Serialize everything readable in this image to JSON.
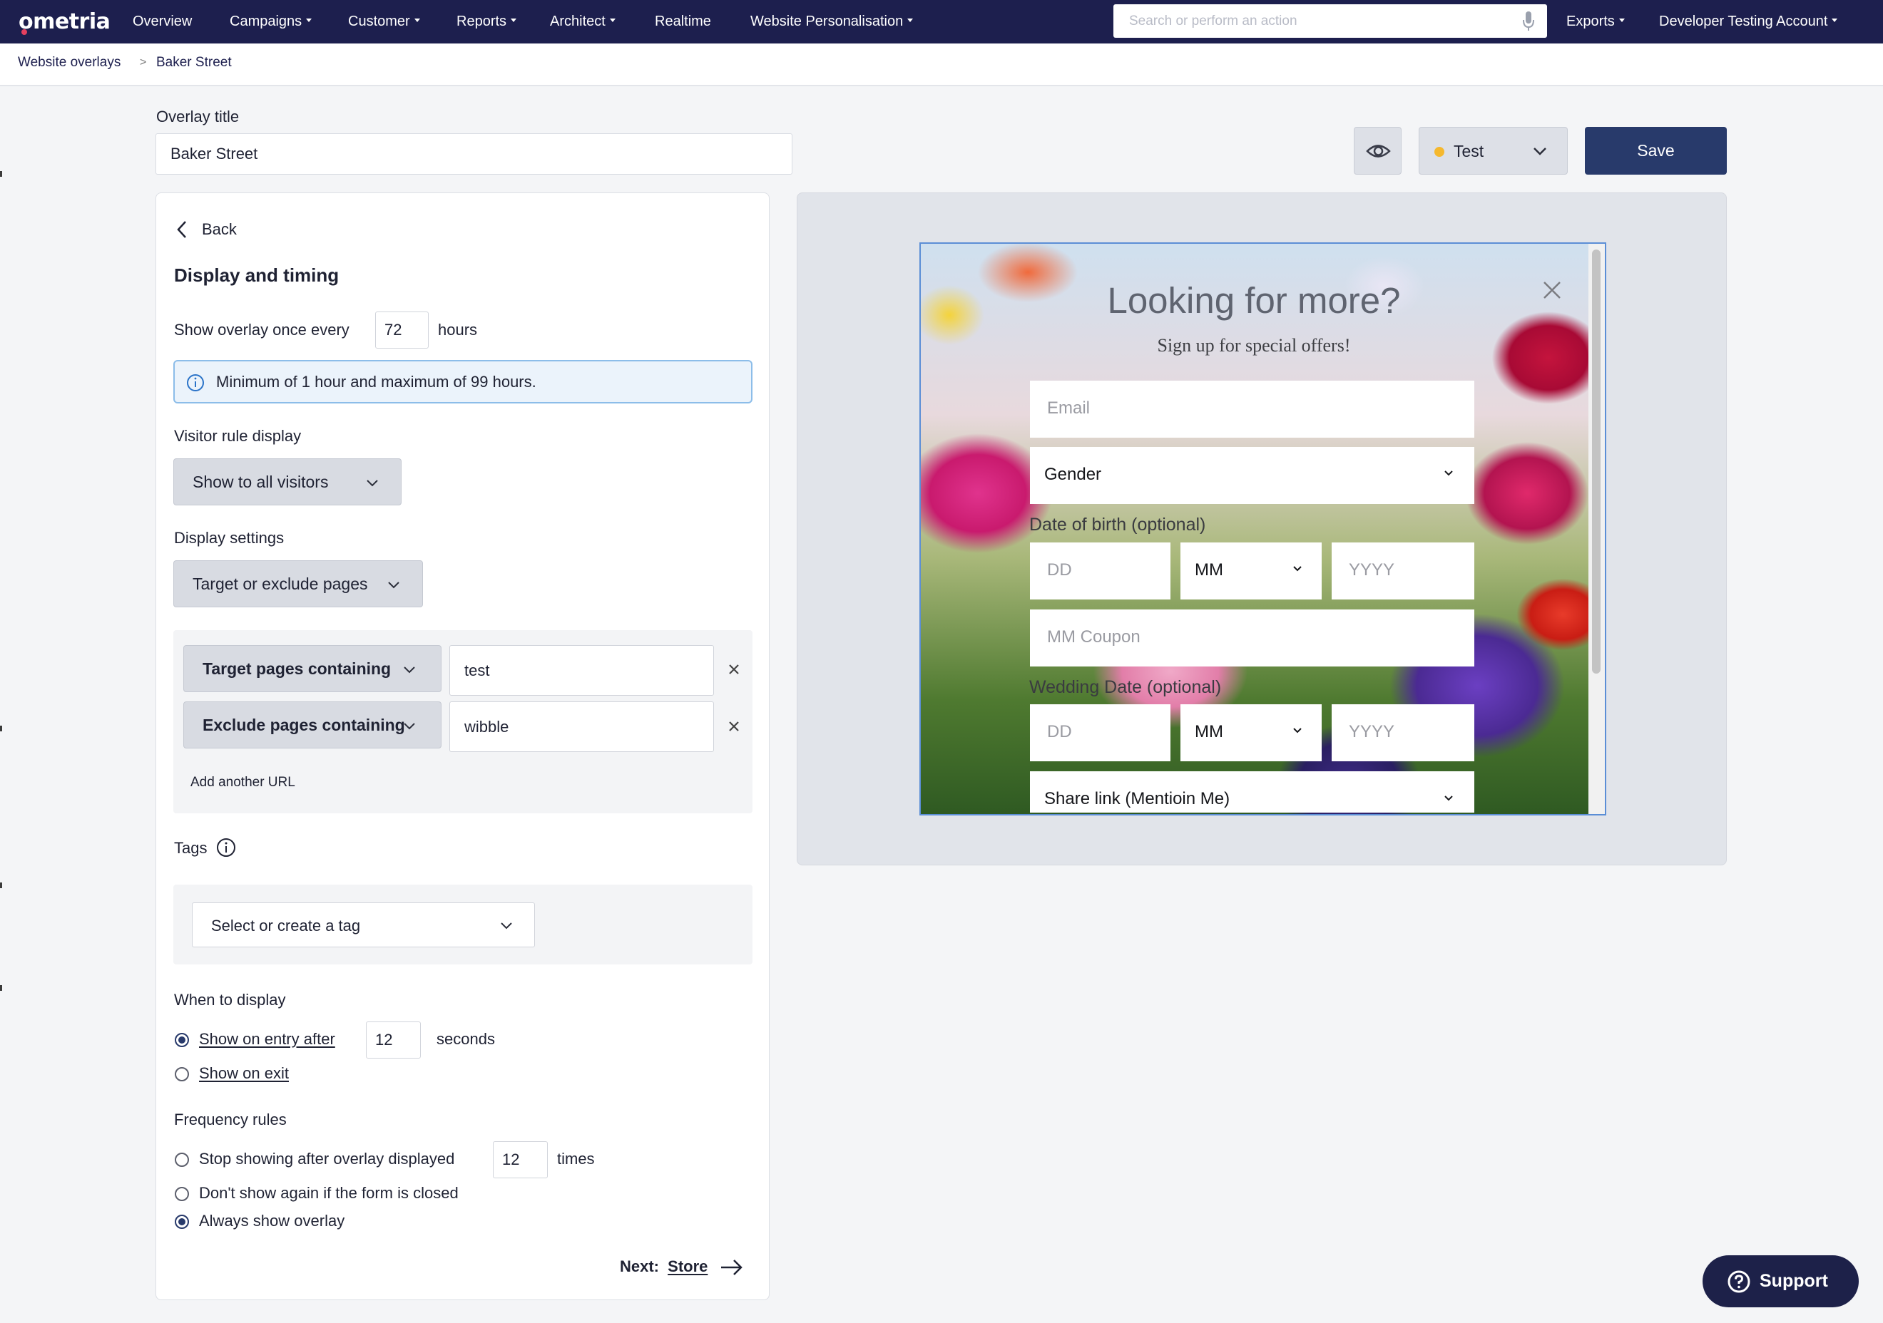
{
  "nav": {
    "logo": "ometria",
    "items": [
      {
        "label": "Overview",
        "caret": false
      },
      {
        "label": "Campaigns",
        "caret": true
      },
      {
        "label": "Customer",
        "caret": true
      },
      {
        "label": "Reports",
        "caret": true
      },
      {
        "label": "Architect",
        "caret": true
      },
      {
        "label": "Realtime",
        "caret": false
      },
      {
        "label": "Website Personalisation",
        "caret": true
      }
    ],
    "search_placeholder": "Search or perform an action",
    "exports": "Exports",
    "account": "Developer Testing Account"
  },
  "breadcrumb": {
    "parent": "Website overlays",
    "separator": ">",
    "current": "Baker Street"
  },
  "overlay_title": {
    "label": "Overlay title",
    "value": "Baker Street"
  },
  "toolbar": {
    "status": "Test",
    "status_color": "#f5b82e",
    "save": "Save"
  },
  "panel": {
    "back": "Back",
    "section_title": "Display and timing",
    "show_once_prefix": "Show overlay once every",
    "show_once_value": "72",
    "show_once_suffix": "hours",
    "info": "Minimum of 1 hour and maximum of 99 hours.",
    "visitor_rule_label": "Visitor rule display",
    "visitor_rule_value": "Show to all visitors",
    "display_settings_label": "Display settings",
    "display_settings_value": "Target or exclude pages",
    "url_rules": [
      {
        "rule": "Target pages containing",
        "value": "test"
      },
      {
        "rule": "Exclude pages containing",
        "value": "wibble"
      }
    ],
    "add_url": "Add another URL",
    "tags_label": "Tags",
    "tag_placeholder": "Select or create a tag",
    "when_label": "When to display",
    "entry_label": "Show on entry after",
    "entry_value": "12",
    "entry_suffix": "seconds",
    "exit_label": "Show on exit",
    "freq_label": "Frequency rules",
    "freq_stop": "Stop showing after overlay displayed",
    "freq_stop_value": "12",
    "freq_stop_suffix": "times",
    "freq_closed": "Don't show again if the form is closed",
    "freq_always": "Always show overlay",
    "next_prefix": "Next:",
    "next_link": "Store"
  },
  "preview": {
    "heading": "Looking for more?",
    "subheading": "Sign up for special offers!",
    "email": "Email",
    "gender": "Gender",
    "dob_label": "Date of birth (optional)",
    "dd": "DD",
    "mm": "MM",
    "yyyy": "YYYY",
    "coupon": "MM Coupon",
    "wedding_label": "Wedding Date (optional)",
    "share": "Share link (Mentioin Me)"
  },
  "support": "Support"
}
